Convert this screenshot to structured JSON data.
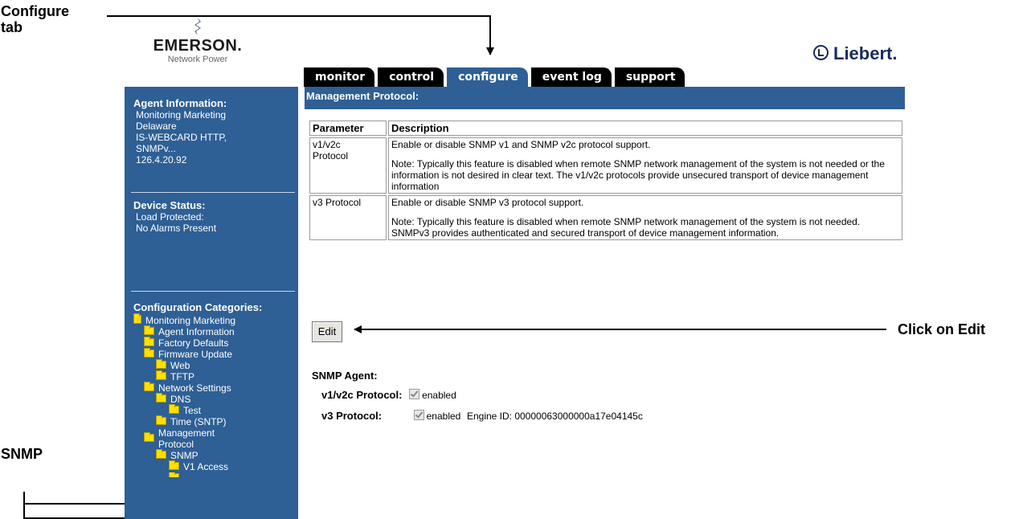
{
  "callouts": {
    "configure_tab": [
      "Configure",
      "tab"
    ],
    "click_on_edit": "Click on Edit",
    "snmp": "SNMP"
  },
  "logos": {
    "emerson_name": "EMERSON.",
    "emerson_sub": "Network Power",
    "liebert": "Liebert."
  },
  "tabs": [
    {
      "label": "monitor",
      "active": false
    },
    {
      "label": "control",
      "active": false
    },
    {
      "label": "configure",
      "active": true
    },
    {
      "label": "event log",
      "active": false
    },
    {
      "label": "support",
      "active": false
    }
  ],
  "sidebar": {
    "agent_info_title": "Agent Information:",
    "agent_info_lines": [
      "Monitoring Marketing",
      "Delaware",
      "IS-WEBCARD HTTP,",
      "SNMPv...",
      "126.4.20.92"
    ],
    "device_status_title": "Device Status:",
    "device_status_lines": [
      "Load Protected:",
      "No Alarms Present"
    ],
    "config_title": "Configuration Categories:",
    "tree": [
      {
        "label": "Monitoring Marketing",
        "level": 0,
        "icon": "root-icon"
      },
      {
        "label": "Agent Information",
        "level": 1
      },
      {
        "label": "Factory Defaults",
        "level": 1
      },
      {
        "label": "Firmware Update",
        "level": 1
      },
      {
        "label": "Web",
        "level": 2
      },
      {
        "label": "TFTP",
        "level": 2
      },
      {
        "label": "Network Settings",
        "level": 1
      },
      {
        "label": "DNS",
        "level": 2
      },
      {
        "label": "Test",
        "level": 3
      },
      {
        "label": "Time (SNTP)",
        "level": 2
      },
      {
        "label": "Management",
        "level": 1,
        "continuation": "Protocol"
      },
      {
        "label": "SNMP",
        "level": 2
      },
      {
        "label": "V1 Access",
        "level": 3
      }
    ]
  },
  "main": {
    "header": "Management Protocol:",
    "table": {
      "columns": [
        "Parameter",
        "Description"
      ],
      "rows": [
        {
          "param": [
            "v1/v2c",
            "Protocol"
          ],
          "desc": [
            "Enable or disable SNMP v1 and SNMP v2c protocol support.",
            "Note: Typically this feature is disabled when remote SNMP network management of the system is not needed or the information is not desired in clear text. The v1/v2c protocols provide unsecured transport of device management information"
          ]
        },
        {
          "param": [
            "v3 Protocol"
          ],
          "desc": [
            "Enable or disable SNMP v3 protocol support.",
            "Note: Typically this feature is disabled when remote SNMP network management of the system is not needed. SNMPv3 provides authenticated and secured transport of device management information."
          ]
        }
      ]
    },
    "edit_label": "Edit",
    "snmp_agent_title": "SNMP Agent:",
    "v1v2c": {
      "label": "v1/v2c Protocol:",
      "checkbox_label": "enabled",
      "checked": true
    },
    "v3": {
      "label": "v3 Protocol:",
      "checkbox_label": "enabled",
      "checked": true,
      "engine_id": "Engine ID: 00000063000000a17e04145c"
    }
  }
}
